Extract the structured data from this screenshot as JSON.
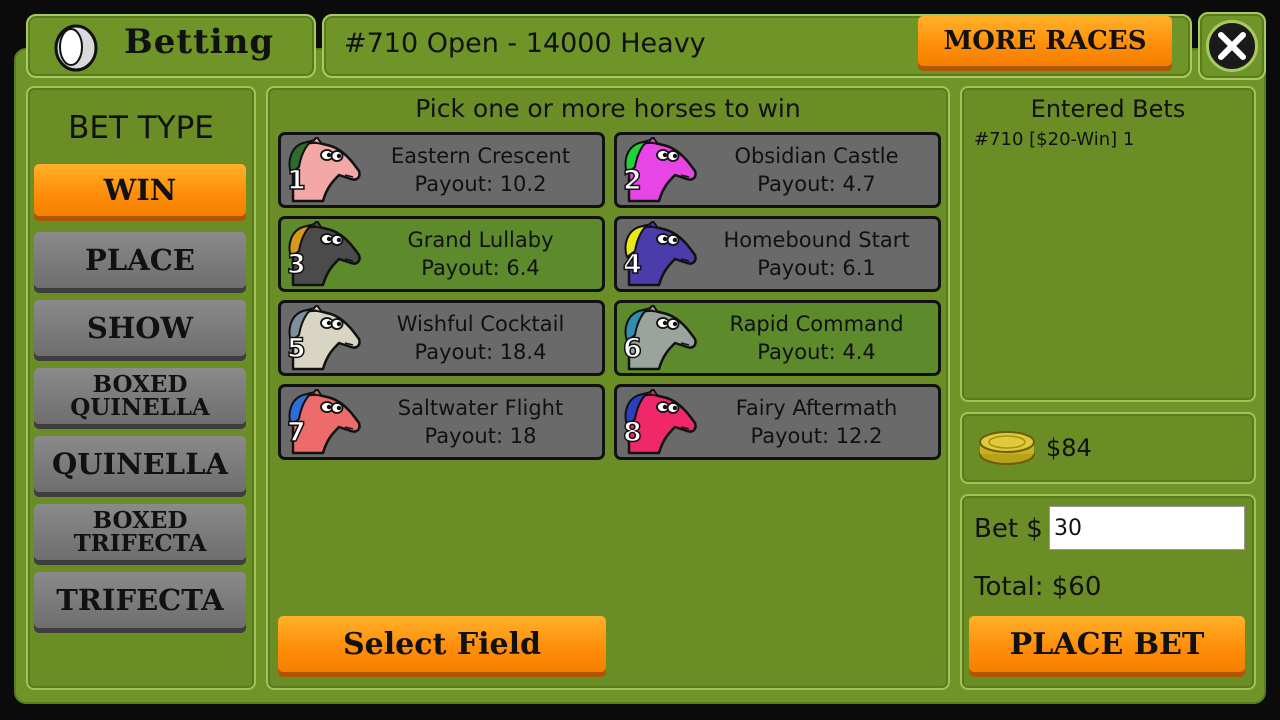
{
  "header": {
    "title": "Betting",
    "race_title": "#710 Open - 14000 Heavy",
    "more_races": "MORE RACES",
    "close_label": "X"
  },
  "bet_types": {
    "heading": "BET TYPE",
    "win": "WIN",
    "place": "PLACE",
    "show": "SHOW",
    "boxed_quinella": "BOXED QUINELLA",
    "quinella": "QUINELLA",
    "boxed_trifecta": "BOXED TRIFECTA",
    "trifecta": "TRIFECTA"
  },
  "horses_panel": {
    "instruction": "Pick one or more horses to win",
    "select_field": "Select Field",
    "horses": [
      {
        "number": "1",
        "name": "Eastern Crescent",
        "payout": "Payout: 10.2",
        "selected": false,
        "body": "#f3a7a6",
        "mane": "#2f6b2f"
      },
      {
        "number": "2",
        "name": "Obsidian Castle",
        "payout": "Payout: 4.7",
        "selected": false,
        "body": "#e845e6",
        "mane": "#1fd23a"
      },
      {
        "number": "3",
        "name": "Grand Lullaby",
        "payout": "Payout: 6.4",
        "selected": true,
        "body": "#4b4b4b",
        "mane": "#d49a1a"
      },
      {
        "number": "4",
        "name": "Homebound Start",
        "payout": "Payout: 6.1",
        "selected": false,
        "body": "#4a3dab",
        "mane": "#e8e81a"
      },
      {
        "number": "5",
        "name": "Wishful Cocktail",
        "payout": "Payout: 18.4",
        "selected": false,
        "body": "#d8d6c2",
        "mane": "#7f8f9a"
      },
      {
        "number": "6",
        "name": "Rapid Command",
        "payout": "Payout: 4.4",
        "selected": true,
        "body": "#9aa39c",
        "mane": "#2f8fb0"
      },
      {
        "number": "7",
        "name": "Saltwater Flight",
        "payout": "Payout: 18",
        "selected": false,
        "body": "#ee6b6b",
        "mane": "#2c6fd8"
      },
      {
        "number": "8",
        "name": "Fairy Aftermath",
        "payout": "Payout: 12.2",
        "selected": false,
        "body": "#f0286a",
        "mane": "#2a3fc0"
      }
    ]
  },
  "entered_bets": {
    "heading": "Entered Bets",
    "items": [
      "#710 [$20-Win] 1"
    ]
  },
  "wallet": {
    "balance": "$84",
    "icon": "coin-icon"
  },
  "bet_form": {
    "bet_label": "Bet $",
    "bet_value": "30",
    "total_label": "Total:",
    "total_value": "$60",
    "place_bet": "PLACE BET"
  },
  "colors": {
    "orange": "#ff9a10",
    "green": "#6f9428",
    "selected_green": "#5d8a2a",
    "gray": "#6a6a6a"
  }
}
